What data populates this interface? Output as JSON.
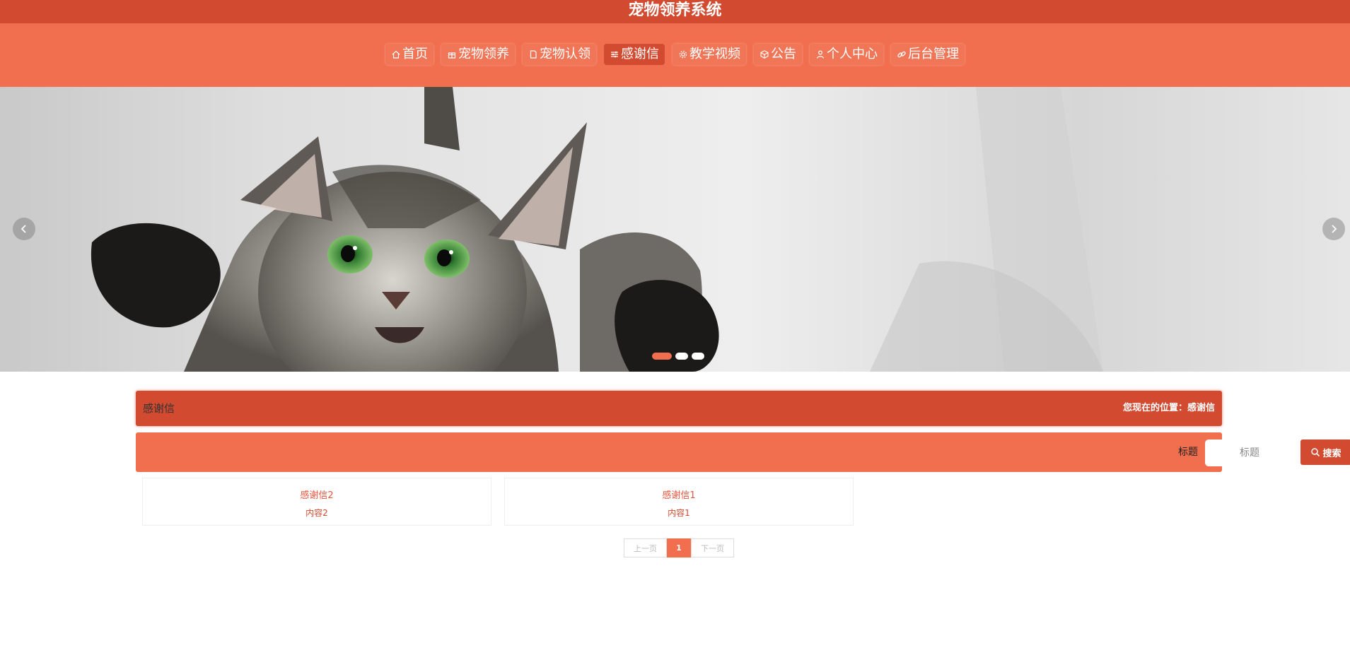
{
  "header": {
    "title": "宠物领养系统"
  },
  "nav": {
    "items": [
      {
        "label": "首页",
        "icon": "home-icon",
        "active": false
      },
      {
        "label": "宠物领养",
        "icon": "gift-icon",
        "active": false
      },
      {
        "label": "宠物认领",
        "icon": "document-icon",
        "active": false
      },
      {
        "label": "感谢信",
        "icon": "sliders-icon",
        "active": true
      },
      {
        "label": "教学视频",
        "icon": "gear-icon",
        "active": false
      },
      {
        "label": "公告",
        "icon": "cube-icon",
        "active": false
      },
      {
        "label": "个人中心",
        "icon": "user-icon",
        "active": false
      },
      {
        "label": "后台管理",
        "icon": "link-icon",
        "active": false
      }
    ]
  },
  "banner": {
    "slide_count": 3,
    "active_slide": 1
  },
  "breadcrumb": {
    "page_name": "感谢信",
    "location": "您现在的位置：感谢信"
  },
  "search": {
    "label": "标题",
    "placeholder": "标题",
    "button_label": "搜索"
  },
  "cards": [
    {
      "title": "感谢信2",
      "content": "内容2"
    },
    {
      "title": "感谢信1",
      "content": "内容1"
    }
  ],
  "pagination": {
    "prev_label": "上一页",
    "current": "1",
    "next_label": "下一页"
  },
  "colors": {
    "primary_dark": "#d24a2f",
    "primary": "#f16e4e"
  }
}
